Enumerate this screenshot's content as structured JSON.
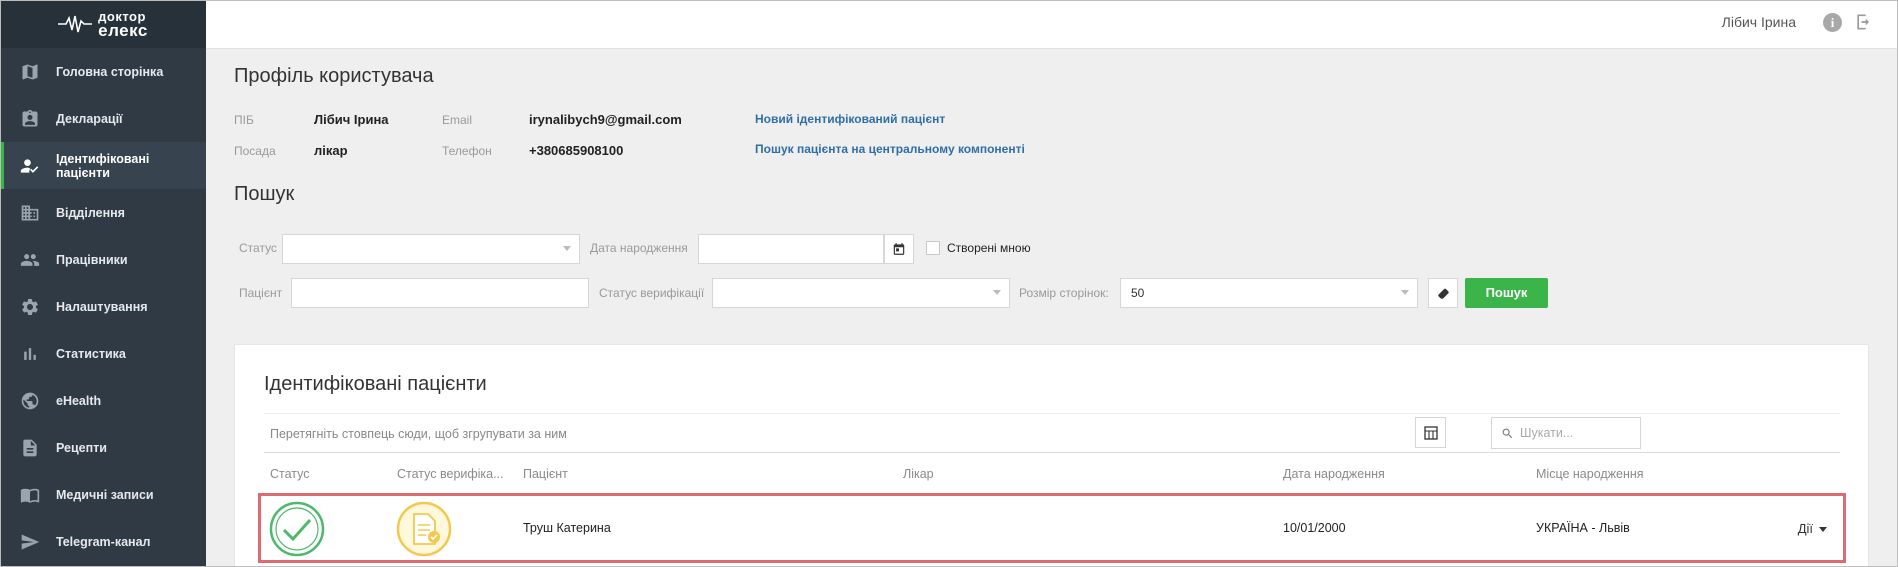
{
  "sidebar": {
    "logo": {
      "line1": "доктор",
      "line2": "елекс"
    },
    "items": [
      {
        "label": "Головна сторінка",
        "icon": "map-icon"
      },
      {
        "label": "Декларації",
        "icon": "clipboard-user-icon"
      },
      {
        "label": "Ідентифіковані пацієнти",
        "icon": "user-check-icon",
        "active": true
      },
      {
        "label": "Відділення",
        "icon": "building-icon"
      },
      {
        "label": "Працівники",
        "icon": "people-icon"
      },
      {
        "label": "Налаштування",
        "icon": "gear-icon"
      },
      {
        "label": "Статистика",
        "icon": "bar-chart-icon"
      },
      {
        "label": "eHealth",
        "icon": "globe-icon"
      },
      {
        "label": "Рецепти",
        "icon": "document-icon"
      },
      {
        "label": "Медичні записи",
        "icon": "book-icon"
      },
      {
        "label": "Telegram-канал",
        "icon": "send-icon"
      }
    ]
  },
  "topbar": {
    "username": "Лібич Ірина",
    "info_icon": "info-icon",
    "logout_icon": "logout-icon"
  },
  "profile": {
    "title": "Профіль користувача",
    "pib_label": "ПІБ",
    "pib_value": "Лібич Ірина",
    "email_label": "Email",
    "email_value": "irynalibych9@gmail.com",
    "position_label": "Посада",
    "position_value": "лікар",
    "phone_label": "Телефон",
    "phone_value": "+380685908100",
    "link_new": "Новий ідентифікований пацієнт",
    "link_search": "Пошук пацієнта на центральному компоненті"
  },
  "search": {
    "title": "Пошук",
    "status_label": "Статус",
    "status_value": "",
    "birth_label": "Дата народження",
    "birth_value": "",
    "created_by_me_label": "Створені мною",
    "patient_label": "Пацієнт",
    "patient_value": "",
    "verif_label": "Статус верифікації",
    "verif_value": "",
    "page_size_label": "Розмір сторінок:",
    "page_size_value": "50",
    "search_button": "Пошук"
  },
  "grid": {
    "title": "Ідентифіковані пацієнти",
    "group_hint": "Перетягніть стовпець сюди, щоб згрупувати за ним",
    "search_placeholder": "Шукати...",
    "columns": [
      "Статус",
      "Статус верифіка...",
      "Пацієнт",
      "Лікар",
      "Дата народження",
      "Місце народження"
    ],
    "rows": [
      {
        "status_icon": "check-circle-icon",
        "verification_icon": "verified-document-icon",
        "patient": "Труш Катерина",
        "doctor": "",
        "birth_date": "10/01/2000",
        "birth_place": "УКРАЇНА - Львів",
        "actions": "Дії"
      }
    ]
  },
  "colors": {
    "sidebar": "#2f3a44",
    "accent": "#3bb44a",
    "link": "#2f6ea6",
    "highlight": "#e06a72",
    "status_ok": "#4cb96a",
    "verif_badge": "#f2c94c"
  }
}
